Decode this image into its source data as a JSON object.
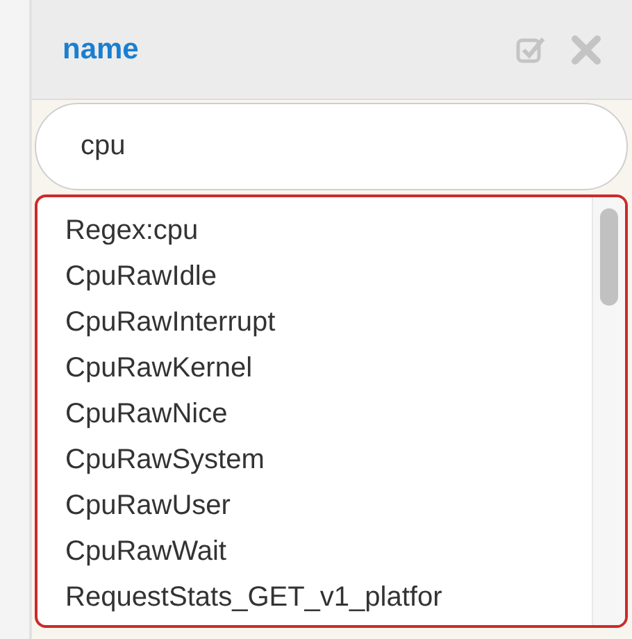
{
  "panel": {
    "title": "name"
  },
  "search": {
    "value": "cpu"
  },
  "list": {
    "items": [
      {
        "label": "Regex:cpu"
      },
      {
        "label": "CpuRawIdle"
      },
      {
        "label": "CpuRawInterrupt"
      },
      {
        "label": "CpuRawKernel"
      },
      {
        "label": "CpuRawNice"
      },
      {
        "label": "CpuRawSystem"
      },
      {
        "label": "CpuRawUser"
      },
      {
        "label": "CpuRawWait"
      },
      {
        "label": "RequestStats_GET_v1_platfor"
      }
    ]
  }
}
